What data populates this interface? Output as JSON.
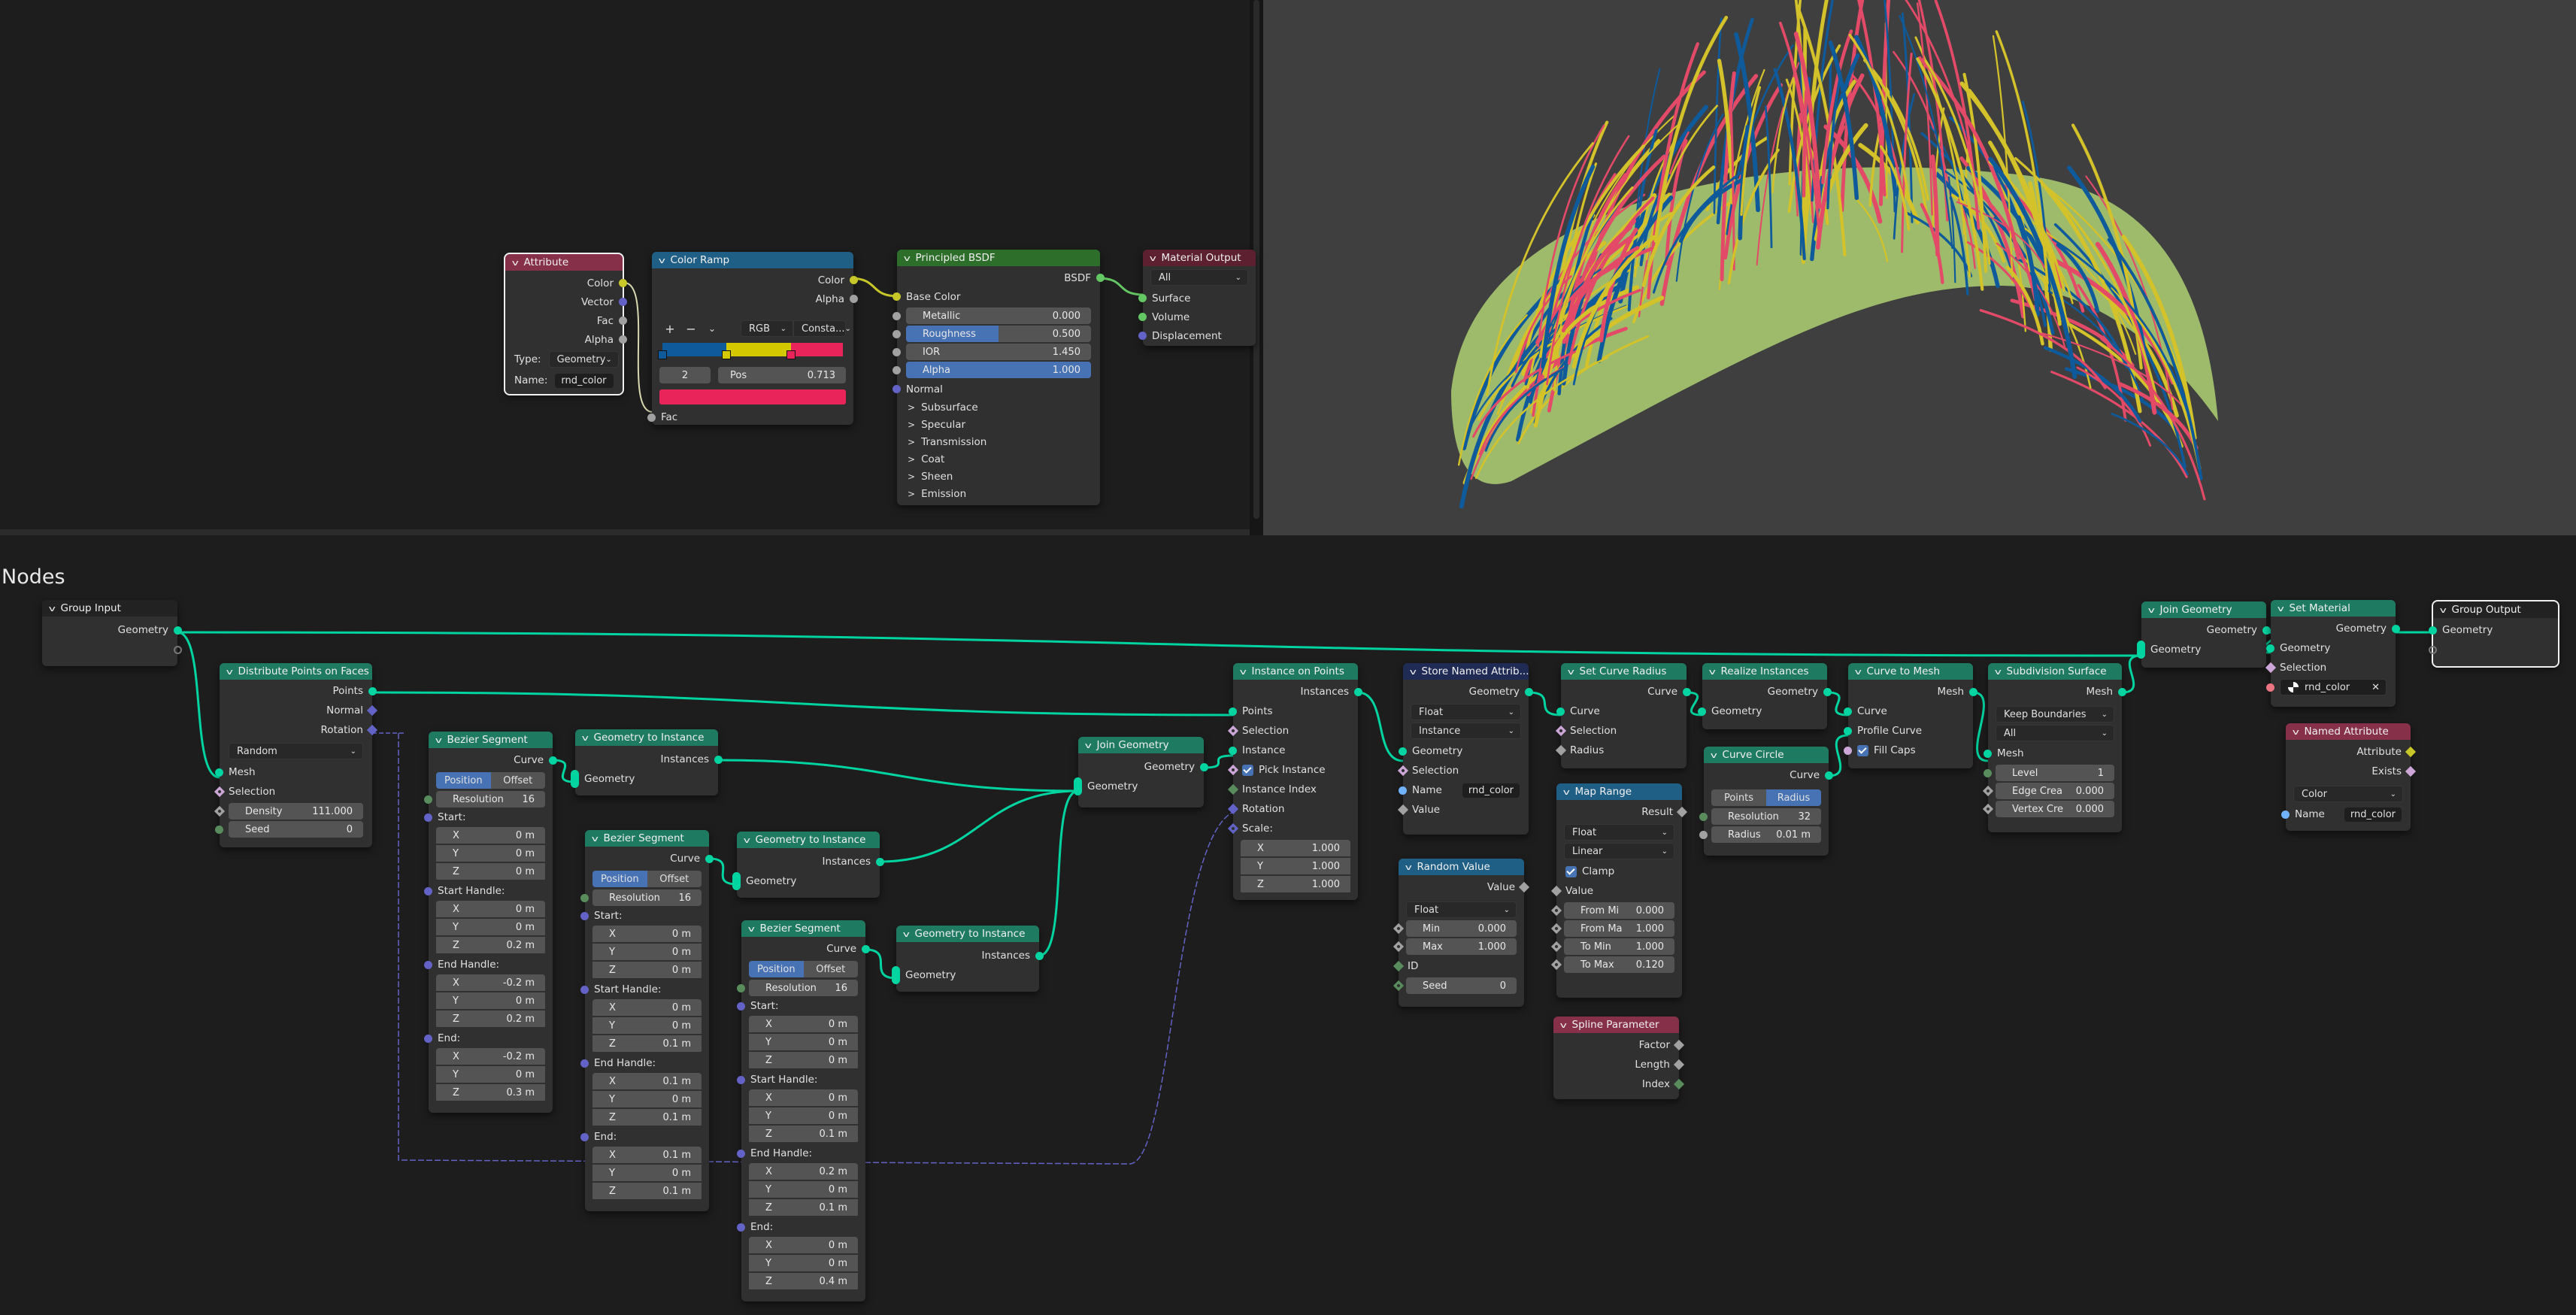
{
  "shader": {
    "attribute": {
      "title": "Attribute",
      "outputs": [
        "Color",
        "Vector",
        "Fac",
        "Alpha"
      ],
      "type_label": "Type:",
      "type_value": "Geometry",
      "name_label": "Name:",
      "name_value": "rnd_color"
    },
    "color_ramp": {
      "title": "Color Ramp",
      "outputs": [
        "Color",
        "Alpha"
      ],
      "add": "+",
      "remove": "−",
      "menu": "⌄",
      "color_mode": "RGB",
      "interpolation": "Consta...",
      "stops": [
        {
          "pos": 0.0,
          "color": "#0e5a9a"
        },
        {
          "pos": 0.355,
          "color": "#d4c800"
        },
        {
          "pos": 0.713,
          "color": "#e8245a"
        }
      ],
      "active_index": "2",
      "pos_label": "Pos",
      "pos_value": "0.713",
      "active_color": "#e8245a",
      "input": "Fac"
    },
    "principled": {
      "title": "Principled BSDF",
      "output": "BSDF",
      "base_color": "Base Color",
      "metallic": {
        "label": "Metallic",
        "value": "0.000",
        "fill": 0
      },
      "roughness": {
        "label": "Roughness",
        "value": "0.500",
        "fill": 0.5
      },
      "ior": {
        "label": "IOR",
        "value": "1.450",
        "fill": 0
      },
      "alpha": {
        "label": "Alpha",
        "value": "1.000",
        "fill": 1
      },
      "normal": "Normal",
      "panels": [
        "Subsurface",
        "Specular",
        "Transmission",
        "Coat",
        "Sheen",
        "Emission"
      ]
    },
    "material_output": {
      "title": "Material Output",
      "target": "All",
      "inputs": [
        "Surface",
        "Volume",
        "Displacement"
      ]
    }
  },
  "geometry": {
    "editor_title": "Nodes",
    "group_input": {
      "title": "Group Input",
      "output": "Geometry"
    },
    "distribute": {
      "title": "Distribute Points on Faces",
      "outputs": [
        "Points",
        "Normal",
        "Rotation"
      ],
      "mode": "Random",
      "mesh": "Mesh",
      "selection": "Selection",
      "density_label": "Density",
      "density": "111.000",
      "seed_label": "Seed",
      "seed": "0"
    },
    "bezier1": {
      "title": "Bezier Segment",
      "output": "Curve",
      "mode_a": "Position",
      "mode_b": "Offset",
      "res_label": "Resolution",
      "res": "16",
      "start": [
        "0 m",
        "0 m",
        "0 m"
      ],
      "start_handle": [
        "0 m",
        "0 m",
        "0.2 m"
      ],
      "end_handle": [
        "-0.2 m",
        "0 m",
        "0.2 m"
      ],
      "end": [
        "-0.2 m",
        "0 m",
        "0.3 m"
      ]
    },
    "bezier2": {
      "title": "Bezier Segment",
      "output": "Curve",
      "mode_a": "Position",
      "mode_b": "Offset",
      "res_label": "Resolution",
      "res": "16",
      "start": [
        "0 m",
        "0 m",
        "0 m"
      ],
      "start_handle": [
        "0 m",
        "0 m",
        "0.1 m"
      ],
      "end_handle": [
        "0.1 m",
        "0 m",
        "0.1 m"
      ],
      "end": [
        "0.1 m",
        "0 m",
        "0.1 m"
      ]
    },
    "bezier3": {
      "title": "Bezier Segment",
      "output": "Curve",
      "mode_a": "Position",
      "mode_b": "Offset",
      "res_label": "Resolution",
      "res": "16",
      "start": [
        "0 m",
        "0 m",
        "0 m"
      ],
      "start_handle": [
        "0 m",
        "0 m",
        "0.1 m"
      ],
      "end_handle": [
        "0.2 m",
        "0 m",
        "0.1 m"
      ],
      "end": [
        "0 m",
        "0 m",
        "0.4 m"
      ]
    },
    "labels": {
      "start": "Start:",
      "start_handle": "Start Handle:",
      "end_handle": "End Handle:",
      "end": "End:",
      "x": "X",
      "y": "Y",
      "z": "Z",
      "scale": "Scale:"
    },
    "g2i": {
      "title": "Geometry to Instance",
      "output": "Instances",
      "input": "Geometry"
    },
    "join1": {
      "title": "Join Geometry",
      "output": "Geometry",
      "input": "Geometry"
    },
    "iop": {
      "title": "Instance on Points",
      "output": "Instances",
      "inputs": [
        "Points",
        "Selection",
        "Instance",
        "Pick Instance",
        "Instance Index",
        "Rotation"
      ],
      "scale": [
        "1.000",
        "1.000",
        "1.000"
      ]
    },
    "store": {
      "title": "Store Named Attrib...",
      "output": "Geometry",
      "data_type": "Float",
      "domain": "Instance",
      "geometry": "Geometry",
      "selection": "Selection",
      "name_label": "Name",
      "name_value": "rnd_color",
      "value": "Value"
    },
    "random": {
      "title": "Random Value",
      "output": "Value",
      "data_type": "Float",
      "min_label": "Min",
      "min": "0.000",
      "max_label": "Max",
      "max": "1.000",
      "id": "ID",
      "seed_label": "Seed",
      "seed": "0"
    },
    "set_radius": {
      "title": "Set Curve Radius",
      "output": "Curve",
      "inputs": [
        "Curve",
        "Selection",
        "Radius"
      ]
    },
    "map_range": {
      "title": "Map Range",
      "output": "Result",
      "data_type": "Float",
      "interp": "Linear",
      "clamp": "Clamp",
      "value": "Value",
      "fields": [
        {
          "label": "From Mi",
          "value": "0.000"
        },
        {
          "label": "From Ma",
          "value": "1.000"
        },
        {
          "label": "To Min",
          "value": "1.000"
        },
        {
          "label": "To Max",
          "value": "0.120"
        }
      ]
    },
    "spline_param": {
      "title": "Spline Parameter",
      "outputs": [
        "Factor",
        "Length",
        "Index"
      ]
    },
    "realize": {
      "title": "Realize Instances",
      "output": "Geometry",
      "input": "Geometry"
    },
    "curve_circle": {
      "title": "Curve Circle",
      "output": "Curve",
      "mode_a": "Points",
      "mode_b": "Radius",
      "res_label": "Resolution",
      "res": "32",
      "radius_label": "Radius",
      "radius": "0.01 m"
    },
    "curve_to_mesh": {
      "title": "Curve to Mesh",
      "output": "Mesh",
      "inputs": [
        "Curve",
        "Profile Curve"
      ],
      "fill_caps": "Fill Caps"
    },
    "subdiv": {
      "title": "Subdivision Surface",
      "output": "Mesh",
      "boundary": "Keep Boundaries",
      "uv": "All",
      "input": "Mesh",
      "level_label": "Level",
      "level": "1",
      "edge_label": "Edge Crea",
      "edge": "0.000",
      "vertex_label": "Vertex Cre",
      "vertex": "0.000"
    },
    "join2": {
      "title": "Join Geometry",
      "output": "Geometry",
      "input": "Geometry"
    },
    "set_material": {
      "title": "Set Material",
      "output": "Geometry",
      "inputs": [
        "Geometry",
        "Selection"
      ],
      "material": "rnd_color"
    },
    "named_attr": {
      "title": "Named Attribute",
      "outputs": [
        "Attribute",
        "Exists"
      ],
      "data_type": "Color",
      "name_label": "Name",
      "name_value": "rnd_color"
    },
    "group_output": {
      "title": "Group Output",
      "input": "Geometry"
    }
  },
  "viewport": {
    "surface_color": "#9dbb6a",
    "strand_colors": [
      "#0e5a9a",
      "#d4c22a",
      "#e24a68"
    ]
  }
}
